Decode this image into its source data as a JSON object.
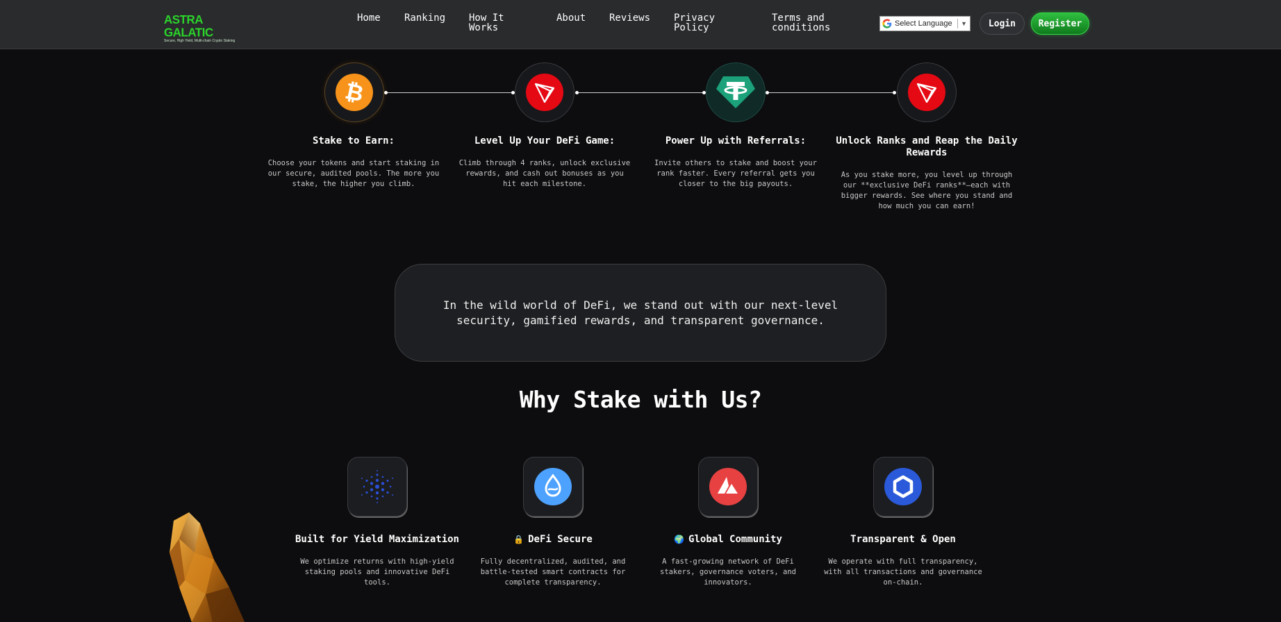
{
  "brand": {
    "name": "ASTRA GALATIC",
    "tagline": "Secure, High Yield, Multi-chain Crypto Staking",
    "color": "#2bd42b"
  },
  "nav": {
    "items": [
      {
        "label": "Home"
      },
      {
        "label": "Ranking"
      },
      {
        "label": "How It Works"
      },
      {
        "label": "About"
      },
      {
        "label": "Reviews"
      },
      {
        "label": "Privacy Policy"
      },
      {
        "label": "Terms and conditions"
      }
    ],
    "language": {
      "selected": "Select Language",
      "icon": "google-icon"
    },
    "login_label": "Login",
    "register_label": "Register",
    "register_color": "#2fbf3f"
  },
  "steps": [
    {
      "title": "Stake to Earn:",
      "description": "Choose your tokens and start staking in our secure, audited pools. The more you stake, the higher you climb.",
      "icon": "bitcoin-icon"
    },
    {
      "title": "Level Up Your DeFi Game:",
      "description": "Climb through 4 ranks, unlock exclusive rewards, and cash out bonuses as you hit each milestone.",
      "icon": "tron-icon"
    },
    {
      "title": "Power Up with Referrals:",
      "description": "Invite others to stake and boost your rank faster. Every referral gets you closer to the big payouts.",
      "icon": "tether-icon"
    },
    {
      "title": "Unlock Ranks and Reap the Daily Rewards",
      "description": "As you stake more, you level up through our **exclusive DeFi ranks**—each with bigger rewards. See where you stand and how much you can earn!",
      "icon": "tron-icon"
    }
  ],
  "quote": {
    "text": "In the wild world of DeFi, we stand out with our next-level security, gamified rewards, and transparent governance."
  },
  "why": {
    "title": "Why Stake with Us?",
    "features": [
      {
        "title": "Built for Yield Maximization",
        "description": "We optimize returns with high-yield staking pools and innovative DeFi tools.",
        "icon": "cardano-icon"
      },
      {
        "title": "DeFi Secure",
        "description": "Fully decentralized, audited, and battle-tested smart contracts for complete transparency.",
        "icon": "sui-icon",
        "emoji": "🔒"
      },
      {
        "title": "Global Community",
        "description": "A fast-growing network of DeFi stakers, governance voters, and innovators.",
        "icon": "avalanche-icon",
        "emoji": "🌍"
      },
      {
        "title": "Transparent & Open",
        "description": "We operate with full transparency, with all transactions and governance on-chain.",
        "icon": "chainlink-icon"
      }
    ]
  }
}
